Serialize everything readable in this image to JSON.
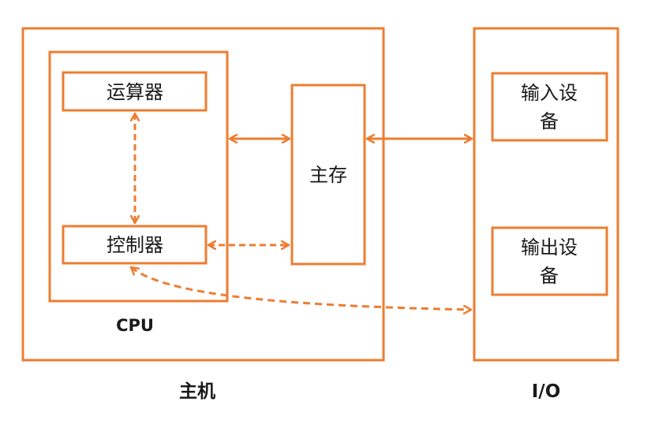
{
  "diagram": {
    "accent_color": "#ED7D31",
    "text_color": "#1a1a1a",
    "host": {
      "label": "主机"
    },
    "cpu": {
      "label": "CPU"
    },
    "alu": {
      "label": "运算器"
    },
    "control_unit": {
      "label": "控制器"
    },
    "main_memory": {
      "label": "主存"
    },
    "io": {
      "label": "I/O"
    },
    "input_device": {
      "line1": "输入设",
      "line2": "备"
    },
    "output_device": {
      "line1": "输出设",
      "line2": "备"
    },
    "connections": [
      {
        "from": "运算器",
        "to": "控制器",
        "style": "dashed",
        "direction": "bidirectional"
      },
      {
        "from": "CPU",
        "to": "主存",
        "style": "solid",
        "direction": "bidirectional"
      },
      {
        "from": "控制器",
        "to": "主存",
        "style": "dashed",
        "direction": "bidirectional"
      },
      {
        "from": "主存",
        "to": "I/O",
        "style": "solid",
        "direction": "bidirectional"
      },
      {
        "from": "控制器",
        "to": "I/O",
        "style": "dashed",
        "direction": "bidirectional"
      }
    ]
  }
}
